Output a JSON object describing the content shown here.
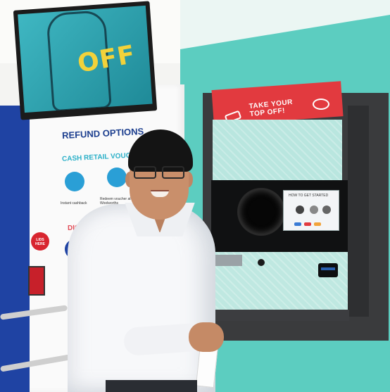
{
  "tv": {
    "text": "OFF"
  },
  "panel": {
    "title": "REFUND OPTIONS",
    "cash_label": "CASH RETAIL VOUCHE",
    "option_1": "Instant cashback",
    "option_2": "Redeem voucher at Woolworths",
    "digital_label": "DIGITAL TR",
    "badge_text": "LIDS HERE"
  },
  "machine": {
    "header_line_1": "TAKE YOUR",
    "header_line_2": "TOP OFF!",
    "screen_title": "HOW TO GET STARTED"
  },
  "colors": {
    "teal_wall": "#5ccdc0",
    "header_red": "#e23a3f",
    "blue_wall": "#1f43a3",
    "tv_text": "#f2d23a"
  }
}
